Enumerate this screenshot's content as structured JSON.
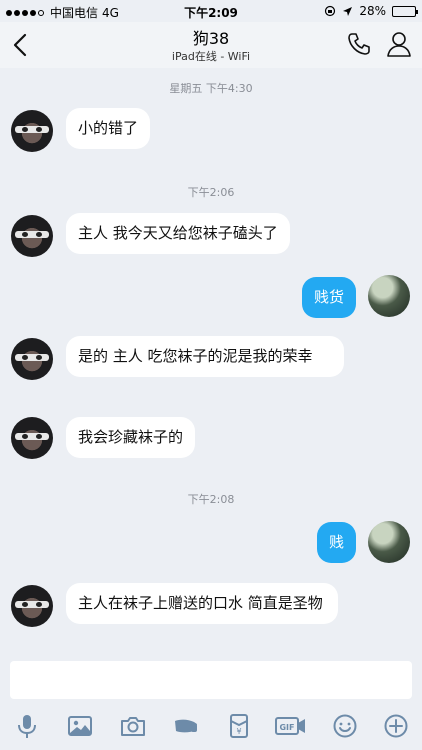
{
  "status_bar": {
    "carrier": "中国电信",
    "network": "4G",
    "time": "下午2:09",
    "battery": "28%",
    "battery_level": 0.28
  },
  "nav": {
    "title": "狗38",
    "subtitle": "iPad在线 - WiFi",
    "back_icon": "chevron-left-icon",
    "phone_icon": "phone-icon",
    "profile_icon": "person-icon"
  },
  "timestamps": [
    "星期五 下午4:30",
    "下午2:06",
    "下午2:08"
  ],
  "messages": [
    {
      "side": "in",
      "text": "小的错了"
    },
    {
      "side": "in",
      "text": "主人 我今天又给您袜子磕头了"
    },
    {
      "side": "out",
      "text": "贱货"
    },
    {
      "side": "in",
      "text": "是的 主人 吃您袜子的泥是我的荣幸"
    },
    {
      "side": "in",
      "text": "我会珍藏袜子的"
    },
    {
      "side": "out",
      "text": "贱"
    },
    {
      "side": "in",
      "text": "主人在袜子上赠送的口水 简直是圣物"
    }
  ],
  "input": {
    "value": "",
    "placeholder": ""
  },
  "toolbar": [
    "microphone-icon",
    "image-icon",
    "camera-icon",
    "shake-icon",
    "red-packet-icon",
    "gif-icon",
    "emoji-icon",
    "plus-icon"
  ],
  "colors": {
    "outgoing_bubble": "#23a9f2",
    "incoming_bubble": "#ffffff",
    "background": "#eceff4",
    "timestamp": "#8a8e96"
  }
}
